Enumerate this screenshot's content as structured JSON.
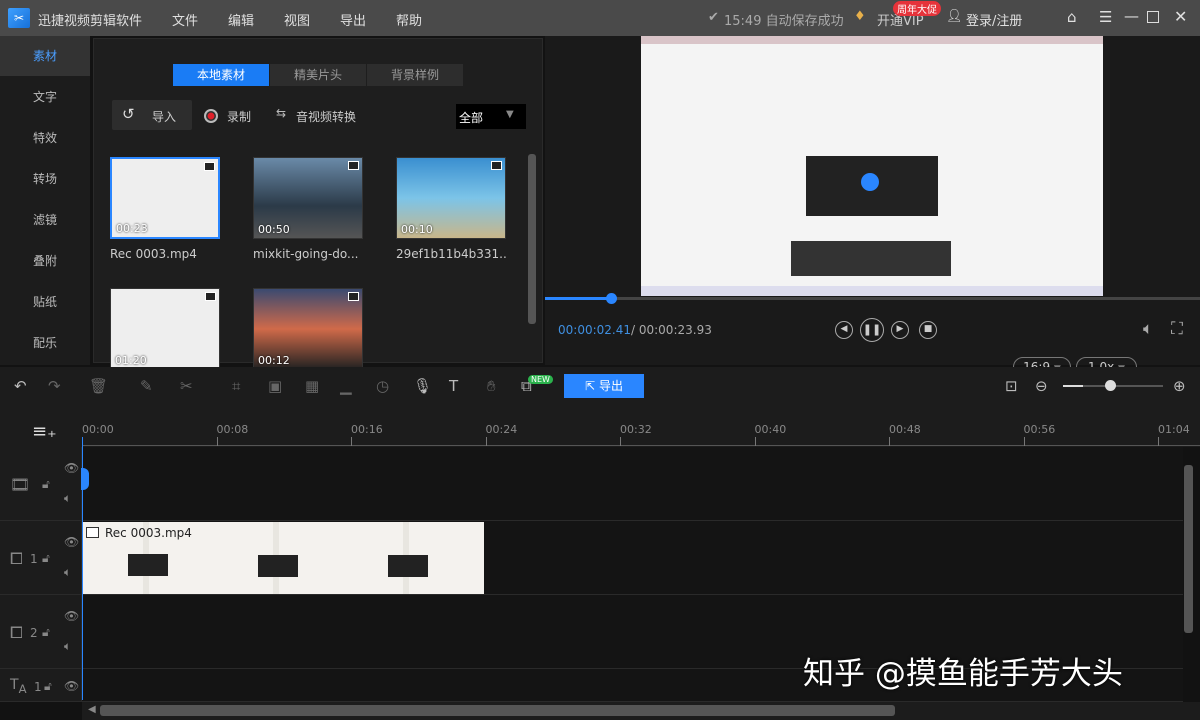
{
  "app": {
    "title": "迅捷视频剪辑软件",
    "menu": [
      "文件",
      "编辑",
      "视图",
      "导出",
      "帮助"
    ],
    "autosave": "15:49 自动保存成功",
    "vip": "开通VIP",
    "vip_badge": "周年大促",
    "login": "登录/注册"
  },
  "sidebar": [
    "素材",
    "文字",
    "特效",
    "转场",
    "滤镜",
    "叠附",
    "贴纸",
    "配乐"
  ],
  "media": {
    "tabs": [
      "本地素材",
      "精美片头",
      "背景样例"
    ],
    "import": "导入",
    "record": "录制",
    "convert": "音视频转换",
    "filter": "全部",
    "items": [
      {
        "name": "Rec 0003.mp4",
        "dur": "00:23"
      },
      {
        "name": "mixkit-going-do...",
        "dur": "00:50"
      },
      {
        "name": "29ef1b11b4b331...",
        "dur": "00:10"
      },
      {
        "name": "",
        "dur": "01:20"
      },
      {
        "name": "",
        "dur": "00:12"
      }
    ]
  },
  "player": {
    "current": "00:00:02.41",
    "total": "/ 00:00:23.93",
    "progress": 0.1,
    "ratio": "16:9",
    "speed": "1.0x"
  },
  "timeline": {
    "export": "导出",
    "new_badge": "NEW",
    "zoom": 0.2,
    "ticks": [
      "00:00",
      "00:08",
      "00:16",
      "00:24",
      "00:32",
      "00:40",
      "00:48",
      "00:56",
      "01:04"
    ],
    "clip": "Rec 0003.mp4",
    "tracks": [
      "",
      "1",
      "2",
      "1"
    ]
  },
  "watermark": "知乎 @摸鱼能手芳大头"
}
